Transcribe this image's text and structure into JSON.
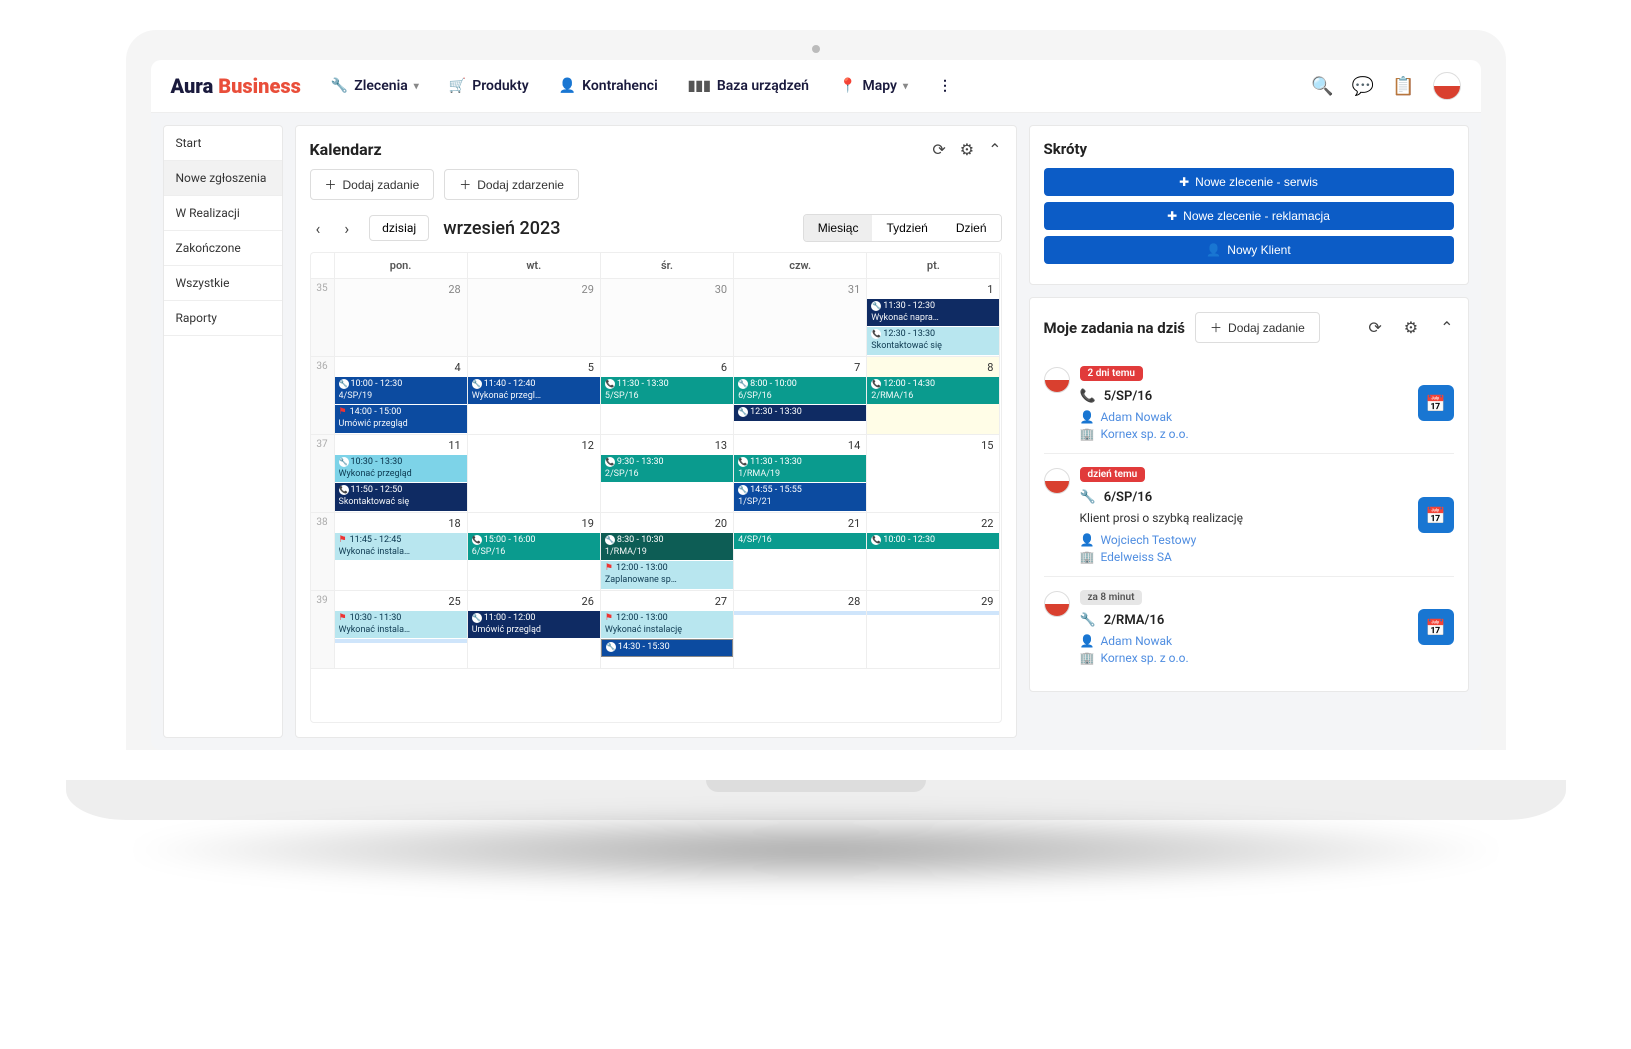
{
  "brand": {
    "a": "Aura",
    "b": "Business"
  },
  "nav": {
    "zlecenia": "Zlecenia",
    "produkty": "Produkty",
    "kontrahenci": "Kontrahenci",
    "baza": "Baza urządzeń",
    "mapy": "Mapy",
    "more": "⋮"
  },
  "sidebar": [
    "Start",
    "Nowe zgłoszenia",
    "W Realizacji",
    "Zakończone",
    "Wszystkie",
    "Raporty"
  ],
  "calendar": {
    "title": "Kalendarz",
    "add_task": "Dodaj zadanie",
    "add_event": "Dodaj zdarzenie",
    "today": "dzisiaj",
    "month_label": "wrzesień 2023",
    "view_month": "Miesiąc",
    "view_week": "Tydzień",
    "view_day": "Dzień",
    "days": [
      "pon.",
      "wt.",
      "śr.",
      "czw.",
      "pt."
    ],
    "weeks": [
      "35",
      "36",
      "37",
      "38",
      "39"
    ],
    "grid": [
      [
        {
          "n": "28",
          "out": true
        },
        {
          "n": "29",
          "out": true
        },
        {
          "n": "30",
          "out": true
        },
        {
          "n": "31",
          "out": true
        },
        {
          "n": "1",
          "ev": [
            {
              "c": "darknavy",
              "t": "11:30 - 12:30",
              "s": "Wykonać napra…",
              "i": "wrench"
            },
            {
              "c": "lcyan",
              "t": "12:30 - 13:30",
              "s": "Skontaktować się",
              "i": "phone"
            }
          ]
        }
      ],
      [
        {
          "n": "4",
          "ev": [
            {
              "c": "blue",
              "t": "10:00 - 12:30",
              "s": "4/SP/19",
              "i": "wrench"
            },
            {
              "c": "blue",
              "t": "14:00 - 15:00",
              "s": "Umówić przegląd",
              "i": "red"
            }
          ]
        },
        {
          "n": "5",
          "ev": [
            {
              "c": "blue",
              "t": "11:40 - 12:40",
              "s": "Wykonać przegl…",
              "i": "wrench"
            }
          ]
        },
        {
          "n": "6",
          "ev": [
            {
              "c": "teal",
              "t": "11:30 - 13:30",
              "s": "5/SP/16",
              "i": "phone"
            }
          ]
        },
        {
          "n": "7",
          "ev": [
            {
              "c": "teal",
              "t": "8:00 - 10:00",
              "s": "6/SP/16",
              "i": "wrench"
            },
            {
              "c": "darknavy",
              "t": "12:30 - 13:30",
              "s": "",
              "i": "wrench"
            }
          ]
        },
        {
          "n": "8",
          "today": true,
          "ev": [
            {
              "c": "teal",
              "t": "12:00 - 14:30",
              "s": "2/RMA/16",
              "i": "phone"
            }
          ]
        }
      ],
      [
        {
          "n": "11",
          "ev": [
            {
              "c": "cyan",
              "t": "10:30 - 13:30",
              "s": "Wykonać przegląd",
              "i": "wrench"
            },
            {
              "c": "darknavy",
              "t": "11:50 - 12:50",
              "s": "Skontaktować się",
              "i": "phone"
            }
          ]
        },
        {
          "n": "12"
        },
        {
          "n": "13",
          "ev": [
            {
              "c": "teal",
              "t": "9:30 - 13:30",
              "s": "2/SP/16",
              "i": "phone"
            }
          ]
        },
        {
          "n": "14",
          "ev": [
            {
              "c": "teal",
              "t": "11:30 - 13:30",
              "s": "1/RMA/19",
              "i": "phone"
            },
            {
              "c": "blue",
              "t": "14:55 - 15:55",
              "s": "1/SP/21",
              "i": "wrench"
            }
          ]
        },
        {
          "n": "15"
        }
      ],
      [
        {
          "n": "18",
          "ev": [
            {
              "c": "lcyan",
              "t": "11:45 - 12:45",
              "s": "Wykonać instala…",
              "i": "red"
            }
          ]
        },
        {
          "n": "19",
          "ev": [
            {
              "c": "teal",
              "t": "15:00 - 16:00",
              "s": "6/SP/16",
              "i": "phone"
            }
          ]
        },
        {
          "n": "20",
          "ev": [
            {
              "c": "darkteal",
              "t": "8:30 - 10:30",
              "s": "1/RMA/19",
              "i": "wrench"
            },
            {
              "c": "lcyan",
              "t": "12:00 - 13:00",
              "s": "Zaplanowane sp…",
              "i": "red"
            }
          ]
        },
        {
          "n": "21",
          "ev": [
            {
              "c": "teal",
              "t": "",
              "s": "4/SP/16"
            }
          ]
        },
        {
          "n": "22",
          "ev": [
            {
              "c": "teal",
              "t": "10:00 - 12:30",
              "s": "",
              "i": "phone"
            }
          ]
        }
      ],
      [
        {
          "n": "25",
          "ev": [
            {
              "c": "lcyan",
              "t": "10:30 - 11:30",
              "s": "Wykonać instala…",
              "i": "red"
            },
            {
              "c": "lblue",
              "t": "",
              "s": ""
            }
          ]
        },
        {
          "n": "26",
          "ev": [
            {
              "c": "darknavy",
              "t": "11:00 - 12:00",
              "s": "Umówić przegląd",
              "i": "wrench"
            }
          ]
        },
        {
          "n": "27",
          "ev": [
            {
              "c": "lcyan",
              "t": "12:00 - 13:00",
              "s": "Wykonać instalację",
              "i": "red"
            },
            {
              "c": "blue",
              "t": "14:30 - 15:30",
              "s": "",
              "i": "wrench",
              "bordered": true
            }
          ]
        },
        {
          "n": "28",
          "ev": [
            {
              "c": "lblue",
              "t": "",
              "s": ""
            }
          ]
        },
        {
          "n": "29",
          "ev": [
            {
              "c": "lblue",
              "t": "",
              "s": ""
            }
          ]
        }
      ]
    ]
  },
  "shortcuts": {
    "title": "Skróty",
    "b1": "Nowe zlecenie - serwis",
    "b2": "Nowe zlecenie - reklamacja",
    "b3": "Nowy Klient"
  },
  "tasks": {
    "title": "Moje zadania na dziś",
    "add": "Dodaj zadanie",
    "items": [
      {
        "badge": "2 dni temu",
        "bclass": "red",
        "icon": "📞",
        "id": "5/SP/16",
        "note": "",
        "person": "Adam Nowak",
        "company": "Kornex sp. z o.o."
      },
      {
        "badge": "dzień temu",
        "bclass": "red",
        "icon": "🔧",
        "id": "6/SP/16",
        "note": "Klient prosi o szybką realizację",
        "person": "Wojciech Testowy",
        "company": "Edelweiss SA"
      },
      {
        "badge": "za 8 minut",
        "bclass": "grey",
        "icon": "🔧",
        "id": "2/RMA/16",
        "note": "",
        "person": "Adam Nowak",
        "company": "Kornex sp. z o.o."
      }
    ]
  }
}
